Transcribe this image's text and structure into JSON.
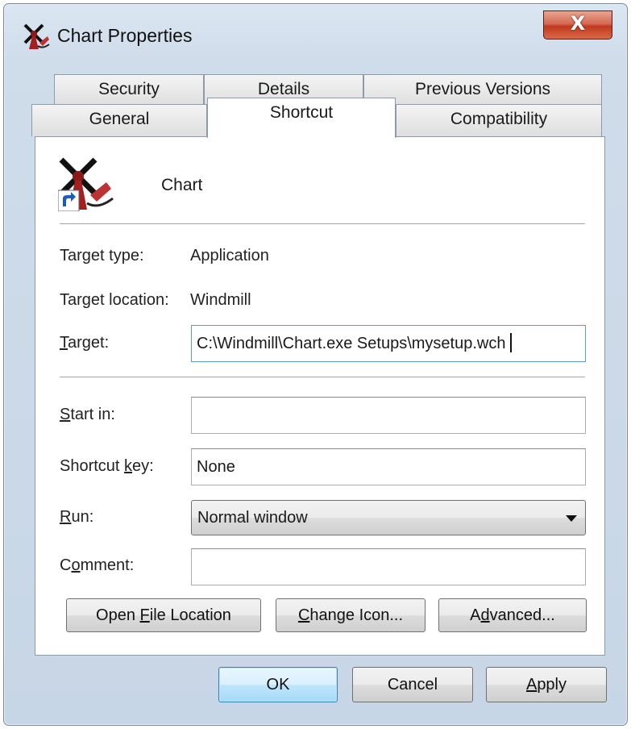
{
  "window": {
    "title": "Chart Properties",
    "close_label": "X"
  },
  "tabs": {
    "back": [
      "Security",
      "Details",
      "Previous Versions"
    ],
    "front": [
      "General",
      "Shortcut",
      "Compatibility"
    ],
    "active": "Shortcut"
  },
  "shortcut": {
    "name": "Chart",
    "target_type_label": "Target type:",
    "target_type_value": "Application",
    "target_location_label": "Target location:",
    "target_location_value": "Windmill",
    "target_label_first": "T",
    "target_label_rest": "arget:",
    "target_value": "C:\\Windmill\\Chart.exe Setups\\mysetup.wch",
    "start_in_label_first": "S",
    "start_in_label_rest": "tart in:",
    "start_in_value": "",
    "shortcut_key_label_pre": "Shortcut ",
    "shortcut_key_label_u": "k",
    "shortcut_key_label_post": "ey:",
    "shortcut_key_value": "None",
    "run_label_first": "R",
    "run_label_rest": "un:",
    "run_value": "Normal window",
    "comment_label_pre": "C",
    "comment_label_u": "o",
    "comment_label_post": "mment:",
    "comment_value": ""
  },
  "actions": {
    "open_file_pre": "Open ",
    "open_file_u": "F",
    "open_file_post": "ile Location",
    "change_icon_u": "C",
    "change_icon_post": "hange Icon...",
    "advanced_pre": "A",
    "advanced_u": "d",
    "advanced_post": "vanced..."
  },
  "dialog_buttons": {
    "ok": "OK",
    "cancel": "Cancel",
    "apply_u": "A",
    "apply_post": "pply"
  },
  "colors": {
    "close_button": "#c7432a",
    "default_button_border": "#3c7fb1",
    "focused_field_border": "#5b9bd5"
  }
}
